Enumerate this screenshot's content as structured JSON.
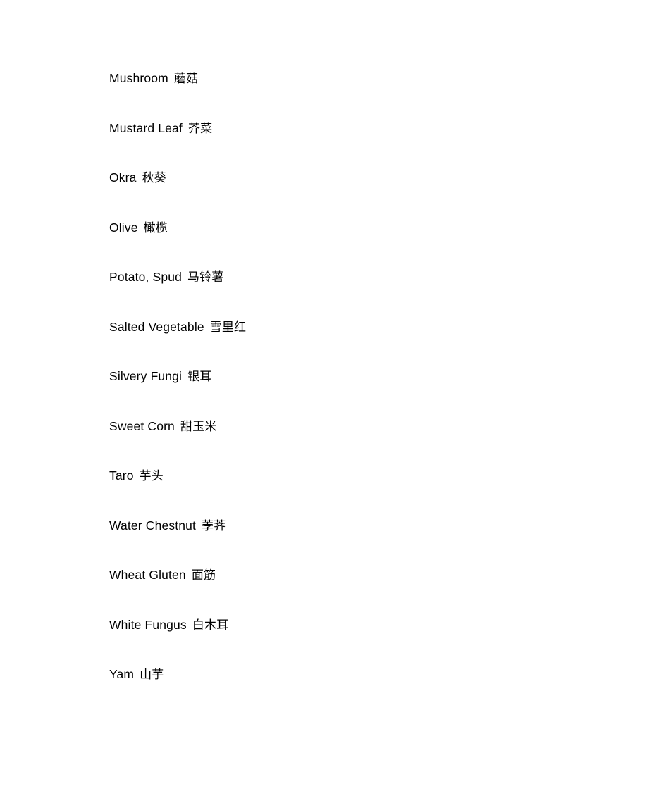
{
  "document": {
    "background_color": "#ffffff",
    "text_color": "#000000",
    "entries": [
      {
        "english": "Mushroom",
        "chinese": "蘑菇"
      },
      {
        "english": "Mustard Leaf",
        "chinese": "芥菜"
      },
      {
        "english": "Okra",
        "chinese": "秋葵"
      },
      {
        "english": "Olive",
        "chinese": "橄榄"
      },
      {
        "english": "Potato, Spud",
        "chinese": "马铃薯"
      },
      {
        "english": "Salted Vegetable",
        "chinese": "雪里红"
      },
      {
        "english": "Silvery Fungi",
        "chinese": "银耳"
      },
      {
        "english": "Sweet Corn",
        "chinese": "甜玉米"
      },
      {
        "english": "Taro",
        "chinese": "芋头"
      },
      {
        "english": "Water Chestnut",
        "chinese": "荸荠"
      },
      {
        "english": "Wheat Gluten",
        "chinese": "面筋"
      },
      {
        "english": "White Fungus",
        "chinese": "白木耳"
      },
      {
        "english": "Yam",
        "chinese": "山芋"
      }
    ]
  }
}
